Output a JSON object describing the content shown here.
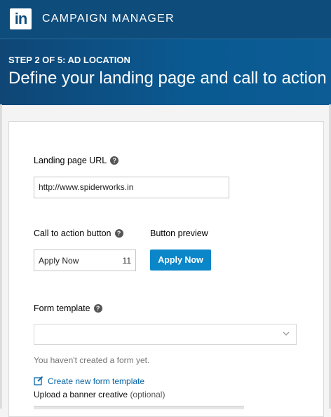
{
  "app": {
    "logo_text": "in",
    "title": "CAMPAIGN MANAGER"
  },
  "header": {
    "step": "STEP 2 OF 5: AD LOCATION",
    "headline": "Define your landing page and call to action"
  },
  "form": {
    "landing_url": {
      "label": "Landing page URL",
      "value": "http://www.spiderworks.in"
    },
    "cta": {
      "label": "Call to action button",
      "value": "Apply Now",
      "remaining": "11"
    },
    "preview": {
      "label": "Button preview",
      "button_label": "Apply Now"
    },
    "form_template": {
      "label": "Form template",
      "selected": "",
      "hint": "You haven't created a form yet.",
      "create_link": "Create new form template"
    },
    "upload": {
      "label": "Upload a banner creative",
      "optional": "(optional)"
    }
  },
  "icons": {
    "help": "help-circle-icon",
    "edit": "edit-icon",
    "chevron": "chevron-down-icon"
  },
  "colors": {
    "brand": "#0e4c7b",
    "button": "#0b86c8",
    "link": "#0a66a8"
  }
}
